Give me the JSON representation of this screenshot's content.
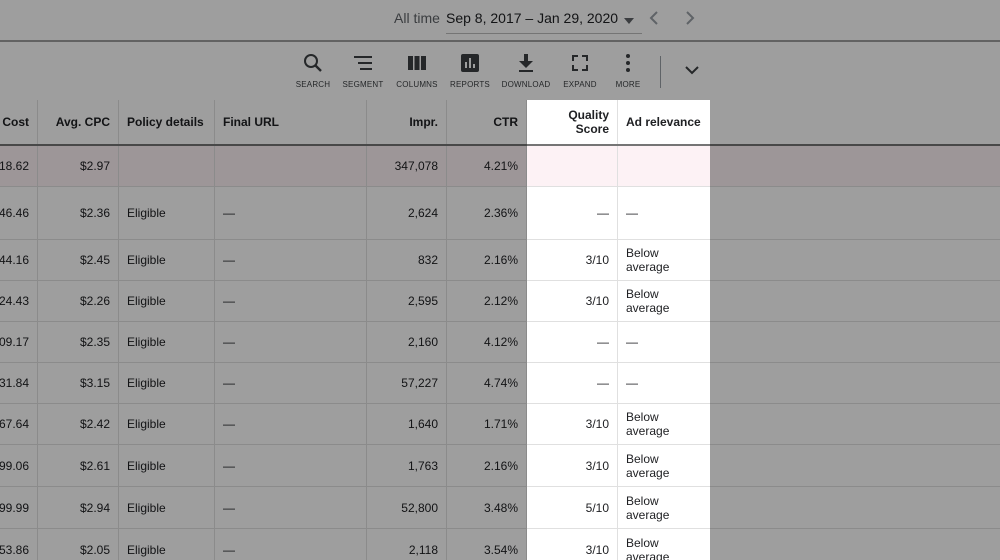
{
  "date_bar": {
    "label": "All time",
    "range": "Sep 8, 2017 – Jan 29, 2020"
  },
  "toolbar": {
    "search": "SEARCH",
    "segment": "SEGMENT",
    "columns": "COLUMNS",
    "reports": "REPORTS",
    "download": "DOWNLOAD",
    "expand": "EXPAND",
    "more": "MORE"
  },
  "table": {
    "headers": {
      "cost": "Cost",
      "avg_cpc": "Avg. CPC",
      "policy": "Policy details",
      "final_url": "Final URL",
      "impr": "Impr.",
      "ctr": "CTR",
      "quality_score": "Quality Score",
      "ad_relevance": "Ad relevance"
    },
    "total": {
      "cost": "18.62",
      "avg_cpc": "$2.97",
      "impr": "347,078",
      "ctr": "4.21%"
    },
    "rows": [
      {
        "cost": "46.46",
        "avg_cpc": "$2.36",
        "policy": "Eligible",
        "final_url": "—",
        "impr": "2,624",
        "ctr": "2.36%",
        "qs": "—",
        "rel1": "—",
        "rel2": ""
      },
      {
        "cost": "44.16",
        "avg_cpc": "$2.45",
        "policy": "Eligible",
        "final_url": "—",
        "impr": "832",
        "ctr": "2.16%",
        "qs": "3/10",
        "rel1": "Below",
        "rel2": "average"
      },
      {
        "cost": "24.43",
        "avg_cpc": "$2.26",
        "policy": "Eligible",
        "final_url": "—",
        "impr": "2,595",
        "ctr": "2.12%",
        "qs": "3/10",
        "rel1": "Below",
        "rel2": "average"
      },
      {
        "cost": "09.17",
        "avg_cpc": "$2.35",
        "policy": "Eligible",
        "final_url": "—",
        "impr": "2,160",
        "ctr": "4.12%",
        "qs": "—",
        "rel1": "—",
        "rel2": ""
      },
      {
        "cost": "31.84",
        "avg_cpc": "$3.15",
        "policy": "Eligible",
        "final_url": "—",
        "impr": "57,227",
        "ctr": "4.74%",
        "qs": "—",
        "rel1": "—",
        "rel2": ""
      },
      {
        "cost": "67.64",
        "avg_cpc": "$2.42",
        "policy": "Eligible",
        "final_url": "—",
        "impr": "1,640",
        "ctr": "1.71%",
        "qs": "3/10",
        "rel1": "Below",
        "rel2": "average"
      },
      {
        "cost": "99.06",
        "avg_cpc": "$2.61",
        "policy": "Eligible",
        "final_url": "—",
        "impr": "1,763",
        "ctr": "2.16%",
        "qs": "3/10",
        "rel1": "Below",
        "rel2": "average"
      },
      {
        "cost": "99.99",
        "avg_cpc": "$2.94",
        "policy": "Eligible",
        "final_url": "—",
        "impr": "52,800",
        "ctr": "3.48%",
        "qs": "5/10",
        "rel1": "Below",
        "rel2": "average"
      },
      {
        "cost": "53.86",
        "avg_cpc": "$2.05",
        "policy": "Eligible",
        "final_url": "—",
        "impr": "2,118",
        "ctr": "3.54%",
        "qs": "3/10",
        "rel1": "Below",
        "rel2": "average"
      }
    ]
  },
  "colors": {
    "total_row_bg": "#fdf2f5",
    "dim_overlay": "rgba(0,0,0,0.38)"
  }
}
